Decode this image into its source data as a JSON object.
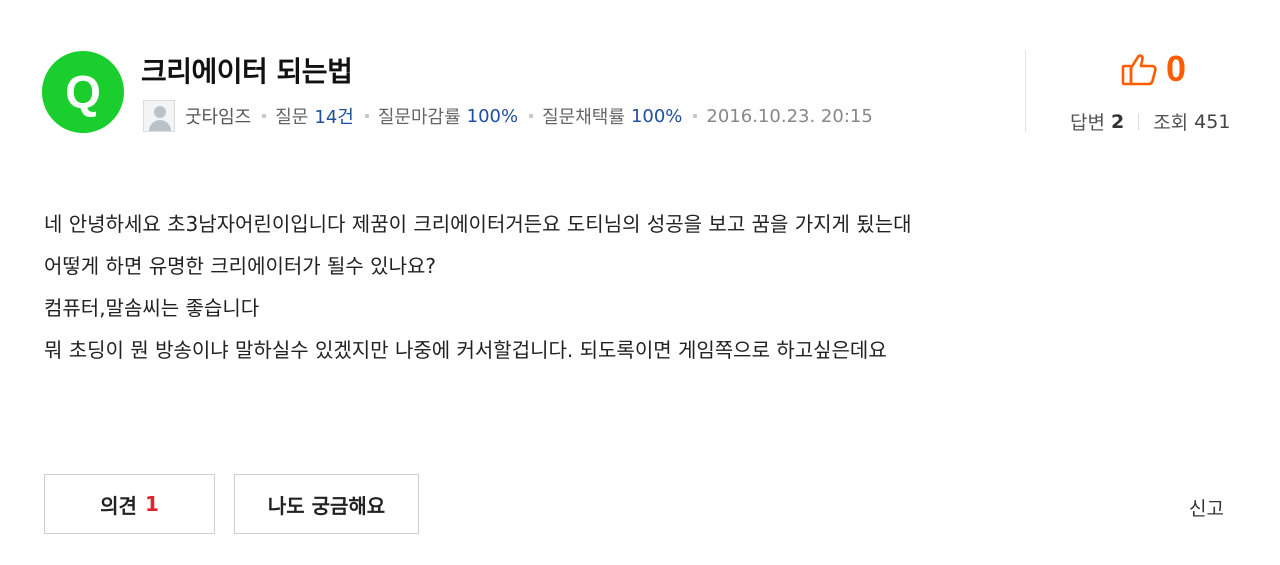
{
  "question": {
    "badge_letter": "Q",
    "title": "크리에이터 되는법"
  },
  "meta": {
    "author": "굿타임즈",
    "questions_label": "질문",
    "questions_value": "14건",
    "close_rate_label": "질문마감률",
    "close_rate_value": "100%",
    "adopt_rate_label": "질문채택률",
    "adopt_rate_value": "100%",
    "date": "2016.10.23. 20:15"
  },
  "likes": {
    "count": "0"
  },
  "stats": {
    "answers_label": "답변",
    "answers_value": "2",
    "views_label": "조회",
    "views_value": "451"
  },
  "body": {
    "lines": [
      "네 안녕하세요 초3남자어린이입니다 제꿈이 크리에이터거든요 도티님의 성공을 보고 꿈을 가지게 됬는대",
      "어떻게 하면 유명한 크리에이터가 될수 있나요?",
      "컴퓨터,말솜씨는 좋습니다",
      "뭐 초딩이 뭔 방송이냐 말하실수 있겠지만 나중에 커서할겁니다. 되도록이면 게임쪽으로 하고싶은데요"
    ]
  },
  "actions": {
    "opinion_label": "의견",
    "opinion_count": "1",
    "curious_label": "나도 궁금해요",
    "report_label": "신고"
  },
  "colors": {
    "badge": "#19ce2d",
    "like": "#ff5c00",
    "stat_number": "#1f4fa1",
    "opinion_count": "#e0232b"
  },
  "icons": {
    "avatar": "default-avatar-icon",
    "like": "thumbs-up-icon"
  }
}
